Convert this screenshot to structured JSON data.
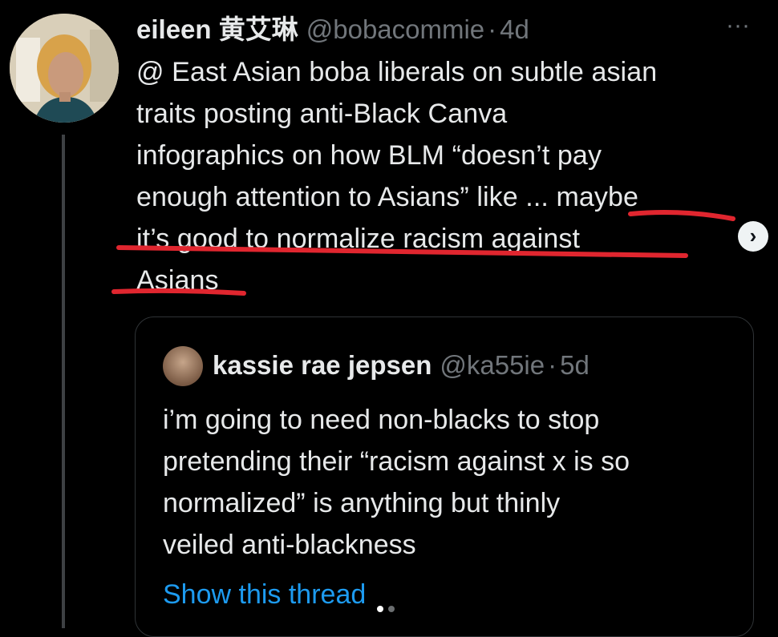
{
  "tweet": {
    "author_name": "eileen 黄艾琳",
    "handle": "@bobacommie",
    "separator": "·",
    "time": "4d",
    "more_label": "···",
    "text": "@ East Asian boba liberals on subtle asian\ntraits posting anti-Black Canva\ninfographics on how BLM “doesn’t pay\nenough attention to Asians” like ... maybe\nit’s good to normalize racism against\nAsians"
  },
  "quote": {
    "author_name": "kassie rae jepsen",
    "handle": "@ka55ie",
    "separator": "·",
    "time": "5d",
    "text": "i’m going to need non-blacks to stop\npretending their “racism against x is so\nnormalized” is anything but thinly\nveiled anti-blackness",
    "show_thread_label": "Show this thread"
  },
  "carousel": {
    "next_label": "›",
    "page_count": 2,
    "active_page": 1
  },
  "colors": {
    "underline": "#e0262f",
    "link": "#1d9bf0",
    "muted": "#71767b"
  },
  "icons": {
    "more": "more-horizontal-icon",
    "next": "chevron-right-icon"
  }
}
